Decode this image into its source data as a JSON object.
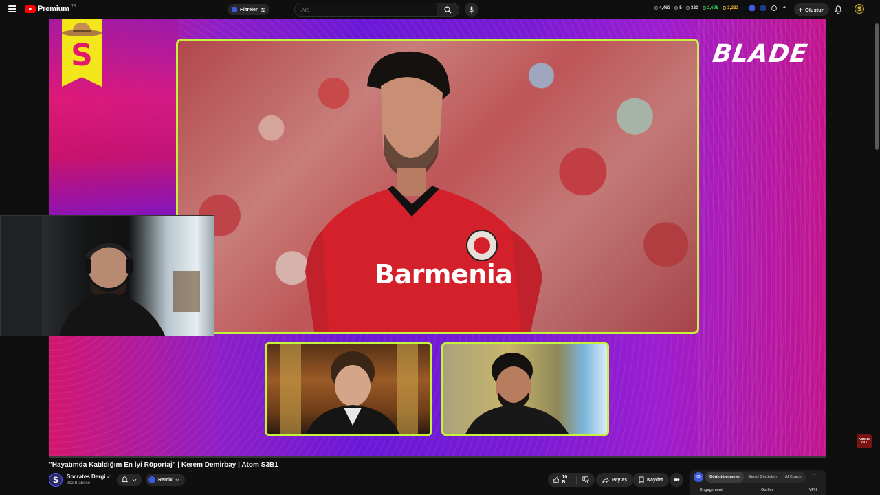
{
  "header": {
    "logo_text": "Premium",
    "logo_region": "TR",
    "filters_label": "Filtreler",
    "search_placeholder": "Ara",
    "stats": {
      "views": "4,463",
      "likes": "5",
      "comments": "320",
      "subs_gain": "2,695",
      "score": "3,333"
    },
    "create_label": "Oluştur"
  },
  "video_overlay": {
    "channel_letter": "S",
    "brand": "BLADE",
    "jersey_sponsor": "Barmenia",
    "subscribe_badge": "ABONE OL!"
  },
  "video": {
    "title": "\"Hayatımda Katıldığım En İyi Röportaj\" | Kerem Demirbay | Atom S3B1",
    "channel_name": "Socrates Dergi",
    "channel_initial": "S",
    "subscribers": "993 B abone",
    "remix_label": "Remix",
    "likes": "10 B",
    "share_label": "Paylaş",
    "save_label": "Kaydet"
  },
  "side_panel": {
    "logo_text": "IQ",
    "tabs": [
      "Görüntülenmeler",
      "Genel Görünüm",
      "AI Coach"
    ],
    "columns": [
      "Engagement",
      "Outlier",
      "VPH"
    ]
  },
  "colors": {
    "accent_lime": "#c5f33c",
    "brand_red": "#ff0000",
    "magenta": "#e2186f",
    "purple": "#6b18d6",
    "yellow_badge": "#f3e61a"
  }
}
